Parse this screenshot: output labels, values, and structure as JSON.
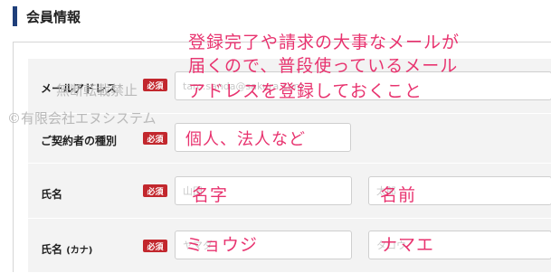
{
  "section": {
    "title": "会員情報"
  },
  "form": {
    "email": {
      "label": "メールアドレス",
      "required": "必須",
      "placeholder": "taro.sanda@sakura.com"
    },
    "contract_type": {
      "label": "ご契約者の種別",
      "required": "必須"
    },
    "name": {
      "label": "氏名",
      "required": "必須",
      "sei_placeholder": "山田",
      "mei_placeholder": "太郎"
    },
    "name_kana": {
      "label": "氏名",
      "label_sub": "(カナ)",
      "required": "必須",
      "sei_placeholder": "ヤマダ",
      "mei_placeholder": "タロウ"
    }
  },
  "annotations": {
    "email_note_line1": "登録完了や請求の大事なメールが",
    "email_note_line2": "届くので、普段使っているメール",
    "email_note_line3": "アドレスを登録しておくこと",
    "contract_type_note": "個人、法人など",
    "sei_note": "名字",
    "mei_note": "名前",
    "sei_kana_note": "ミョウジ",
    "mei_kana_note": "ナマエ"
  },
  "watermark": {
    "line1": "無断転載禁止",
    "line2": "©有限会社エヌシステム"
  },
  "colors": {
    "accent_bar": "#1f3f7a",
    "required_badge": "#c2272d",
    "annotation": "#e8336f",
    "row_background": "#f3f3f3"
  }
}
